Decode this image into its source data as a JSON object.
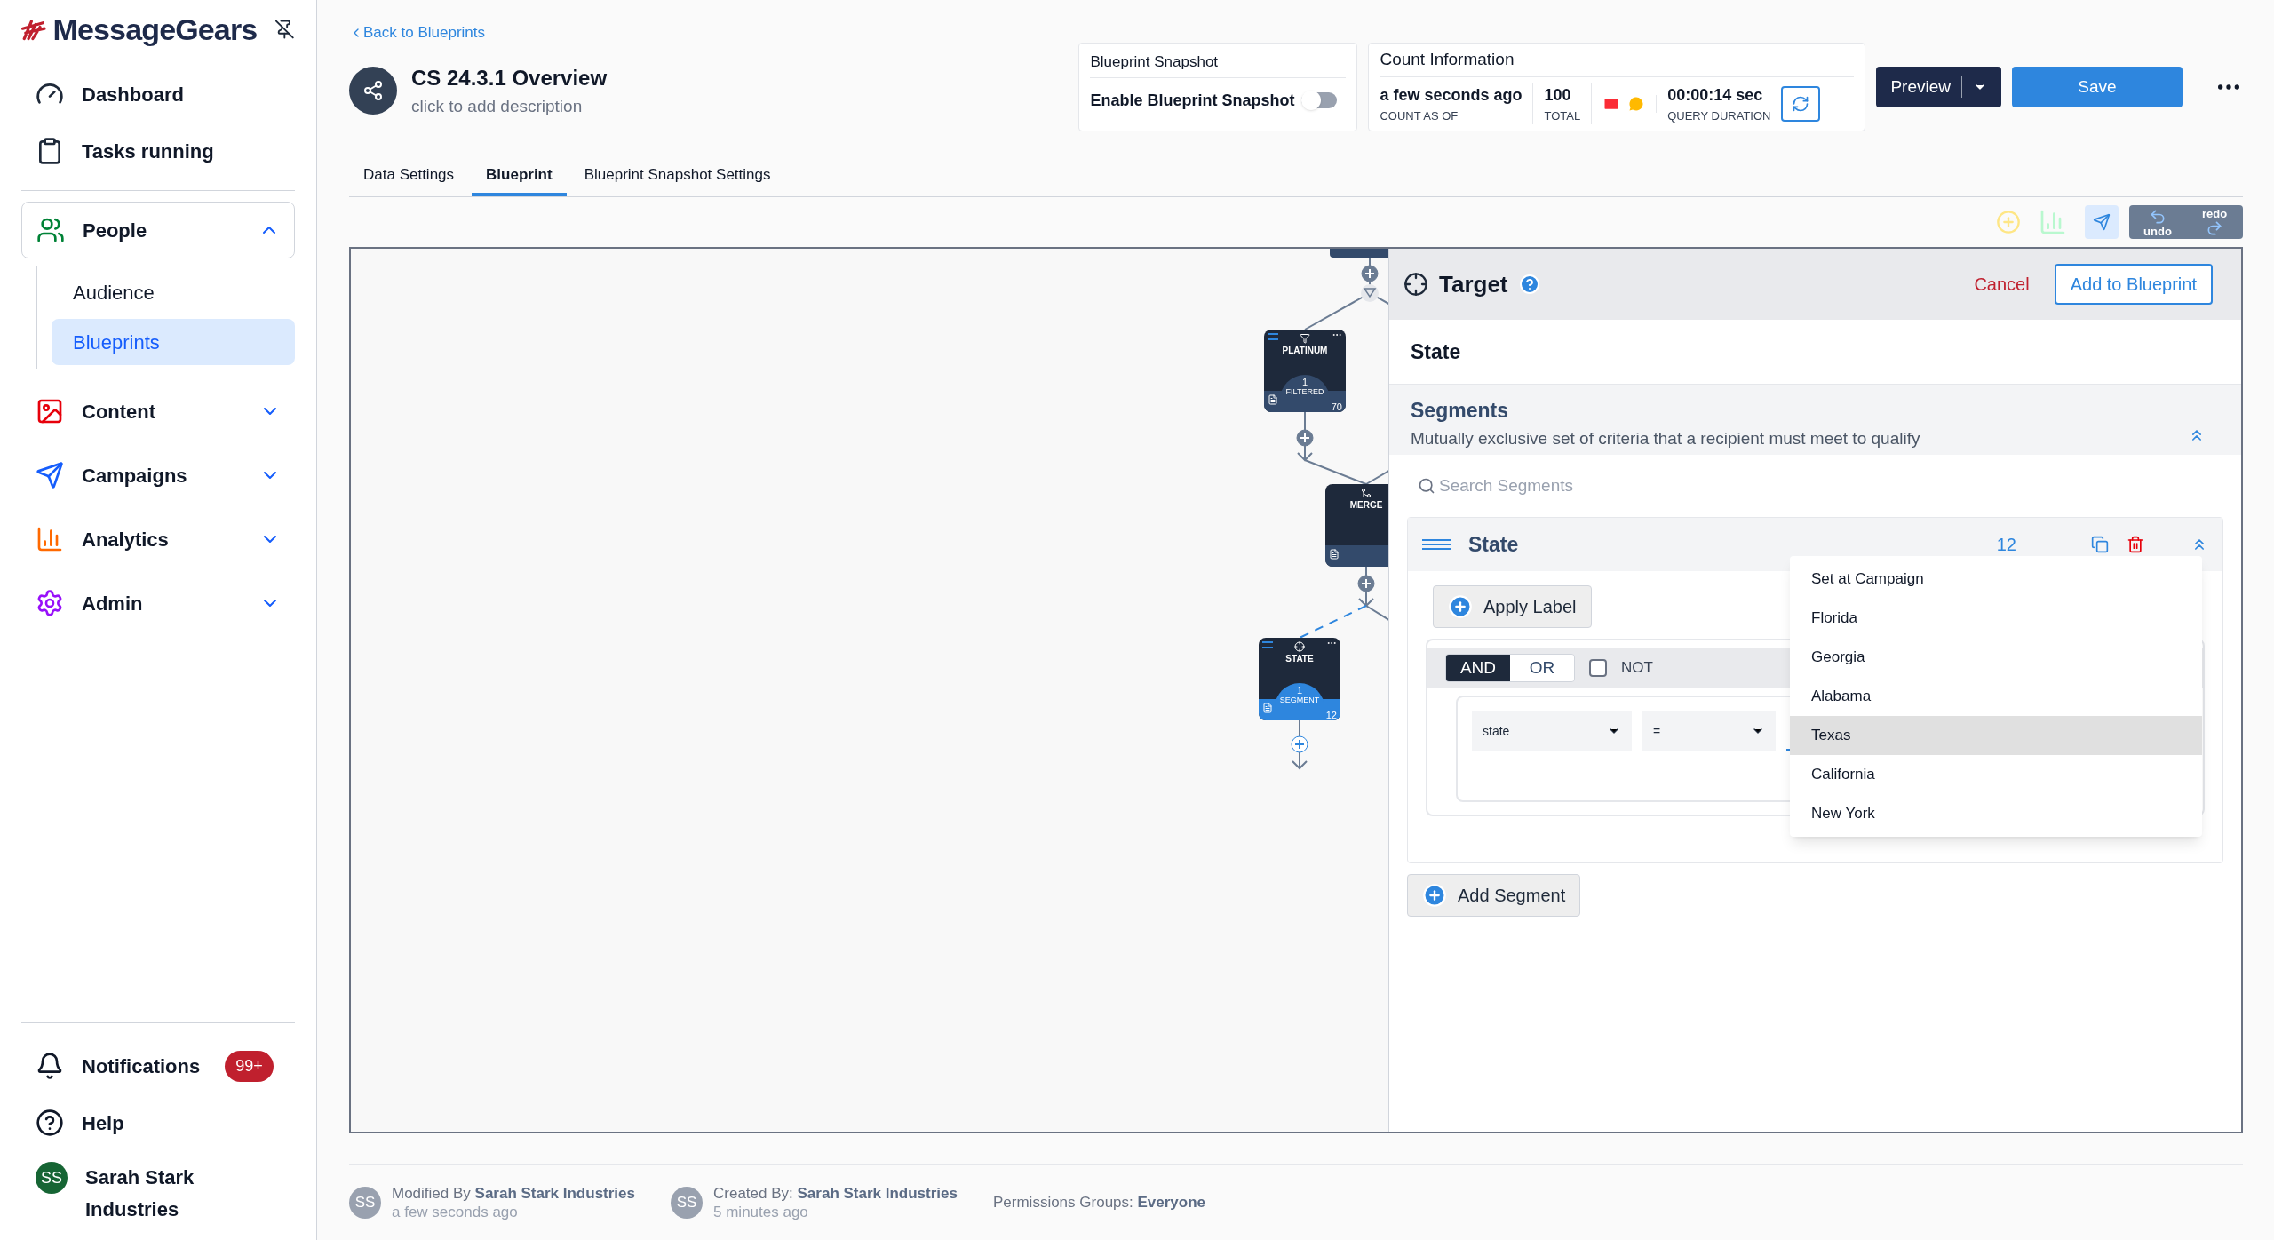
{
  "sidebar": {
    "logo": "MessageGears",
    "top_items": [
      {
        "label": "Dashboard"
      },
      {
        "label": "Tasks running"
      }
    ],
    "sections": [
      {
        "label": "People",
        "expanded": true,
        "children": [
          {
            "label": "Audience",
            "selected": false
          },
          {
            "label": "Blueprints",
            "selected": true
          }
        ]
      },
      {
        "label": "Content",
        "expanded": false
      },
      {
        "label": "Campaigns",
        "expanded": false
      },
      {
        "label": "Analytics",
        "expanded": false
      },
      {
        "label": "Admin",
        "expanded": false
      }
    ],
    "notifications": {
      "label": "Notifications",
      "badge": "99+"
    },
    "help": "Help",
    "user": {
      "initials": "SS",
      "name": "Sarah Stark Industries"
    }
  },
  "header": {
    "back_link": "Back to Blueprints",
    "title": "CS 24.3.1 Overview",
    "description": "click to add description",
    "snapshot": {
      "title": "Blueprint Snapshot",
      "label": "Enable Blueprint Snapshot",
      "on": false
    },
    "count_info": {
      "title": "Count Information",
      "count_as_of": "a few seconds ago",
      "count_as_of_label": "COUNT AS OF",
      "total": "100",
      "total_label": "TOTAL",
      "query_duration": "00:00:14 sec",
      "query_duration_label": "QUERY DURATION"
    },
    "preview_button": "Preview",
    "save_button": "Save"
  },
  "tabs": [
    {
      "label": "Data Settings",
      "selected": false
    },
    {
      "label": "Blueprint",
      "selected": true
    },
    {
      "label": "Blueprint Snapshot Settings",
      "selected": false
    }
  ],
  "toolbar": {
    "undo": "undo",
    "redo": "redo"
  },
  "canvas": {
    "nodes": [
      {
        "kind": "filter",
        "title": "PLATINUM",
        "count": "1",
        "count_label": "FILTERED",
        "total": "70",
        "active": false
      },
      {
        "kind": "merge",
        "title": "MERGE",
        "active": false
      },
      {
        "kind": "target",
        "title": "STATE",
        "count": "1",
        "count_label": "SEGMENT",
        "total": "12",
        "active": true
      }
    ]
  },
  "panel": {
    "title": "Target",
    "cancel": "Cancel",
    "add_button": "Add to Blueprint",
    "name": "State",
    "segments": {
      "title": "Segments",
      "description": "Mutually exclusive set of criteria that a recipient must meet to qualify",
      "search_placeholder": "Search Segments",
      "segment": {
        "name": "State",
        "count": "12",
        "apply_label": "Apply Label",
        "logic": [
          {
            "label": "AND",
            "selected": true
          },
          {
            "label": "OR",
            "selected": false
          }
        ],
        "not": {
          "label": "NOT",
          "checked": false
        },
        "field": "state",
        "operator": "=",
        "dropdown": [
          {
            "label": "Set at Campaign",
            "selected": false
          },
          {
            "label": "Florida",
            "selected": false
          },
          {
            "label": "Georgia",
            "selected": false
          },
          {
            "label": "Alabama",
            "selected": false
          },
          {
            "label": "Texas",
            "selected": true
          },
          {
            "label": "California",
            "selected": false
          },
          {
            "label": "New York",
            "selected": false
          }
        ]
      },
      "add_segment": "Add Segment"
    }
  },
  "footer": [
    {
      "initials": "SS",
      "text": "Modified By **Sarah Stark Industries**",
      "time": "a few seconds ago"
    },
    {
      "initials": "SS",
      "text": "Created By: **Sarah Stark Industries**",
      "time": "5 minutes ago"
    },
    {
      "text": "Permissions Groups: **Everyone**"
    }
  ]
}
